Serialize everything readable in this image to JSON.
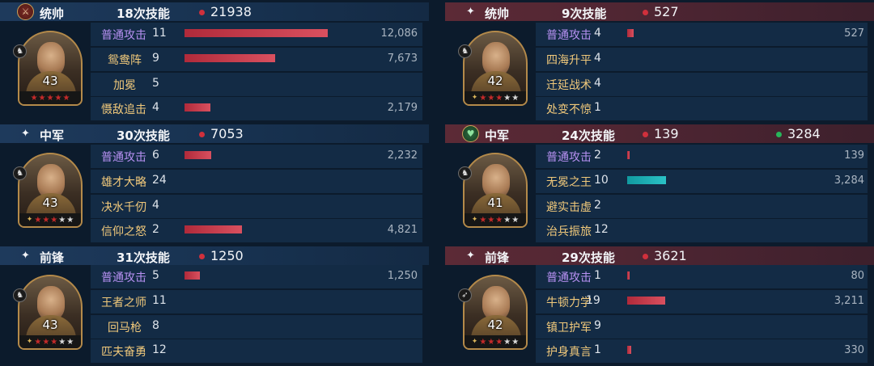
{
  "left": {
    "groups": [
      {
        "role": "统帅",
        "icon": "sword-badge-icon",
        "skills_used": "18次技能",
        "damage_total": "21938",
        "general": {
          "level": "43",
          "stars_red": 5,
          "stars_total": 5,
          "type_icon": "cavalry-icon"
        },
        "rows": [
          {
            "name": "普通攻击",
            "kind": "normal",
            "count": "11",
            "value": "12,086",
            "bar": 1.0,
            "bar_color": "red"
          },
          {
            "name": "鸳鸯阵",
            "kind": "skill",
            "count": "9",
            "value": "7,673",
            "bar": 0.635,
            "bar_color": "red"
          },
          {
            "name": "加冕",
            "kind": "skill",
            "count": "5",
            "value": "",
            "bar": 0,
            "bar_color": "red"
          },
          {
            "name": "慑敌追击",
            "kind": "skill",
            "count": "4",
            "value": "2,179",
            "bar": 0.18,
            "bar_color": "red"
          }
        ]
      },
      {
        "role": "中军",
        "icon": "sparkle-icon",
        "skills_used": "30次技能",
        "damage_total": "7053",
        "general": {
          "level": "43",
          "stars_red": 3,
          "stars_total": 5,
          "type_icon": "cavalry-icon"
        },
        "rows": [
          {
            "name": "普通攻击",
            "kind": "normal",
            "count": "6",
            "value": "2,232",
            "bar": 0.185,
            "bar_color": "red"
          },
          {
            "name": "雄才大略",
            "kind": "skill",
            "count": "24",
            "value": "",
            "bar": 0,
            "bar_color": "red"
          },
          {
            "name": "决水千仞",
            "kind": "skill",
            "count": "4",
            "value": "",
            "bar": 0,
            "bar_color": "red"
          },
          {
            "name": "信仰之怒",
            "kind": "skill",
            "count": "2",
            "value": "4,821",
            "bar": 0.4,
            "bar_color": "red"
          }
        ]
      },
      {
        "role": "前锋",
        "icon": "sparkle-icon",
        "skills_used": "31次技能",
        "damage_total": "1250",
        "general": {
          "level": "43",
          "stars_red": 3,
          "stars_total": 5,
          "type_icon": "cavalry-icon"
        },
        "rows": [
          {
            "name": "普通攻击",
            "kind": "normal",
            "count": "5",
            "value": "1,250",
            "bar": 0.105,
            "bar_color": "red"
          },
          {
            "name": "王者之师",
            "kind": "skill",
            "count": "11",
            "value": "",
            "bar": 0,
            "bar_color": "red"
          },
          {
            "name": "回马枪",
            "kind": "skill",
            "count": "8",
            "value": "",
            "bar": 0,
            "bar_color": "red"
          },
          {
            "name": "匹夫奋勇",
            "kind": "skill",
            "count": "12",
            "value": "",
            "bar": 0,
            "bar_color": "red"
          }
        ]
      }
    ]
  },
  "right": {
    "groups": [
      {
        "role": "统帅",
        "icon": "sparkle-icon",
        "skills_used": "9次技能",
        "damage_total": "527",
        "heal_total": "",
        "general": {
          "level": "42",
          "stars_red": 3,
          "stars_total": 5,
          "type_icon": "cavalry-icon"
        },
        "rows": [
          {
            "name": "普通攻击",
            "kind": "normal",
            "count": "4",
            "value": "527",
            "bar": 0.043,
            "bar_color": "red"
          },
          {
            "name": "四海升平",
            "kind": "skill",
            "count": "4",
            "value": "",
            "bar": 0,
            "bar_color": "red"
          },
          {
            "name": "迁延战术",
            "kind": "skill",
            "count": "4",
            "value": "",
            "bar": 0,
            "bar_color": "red"
          },
          {
            "name": "处变不惊",
            "kind": "skill",
            "count": "1",
            "value": "",
            "bar": 0,
            "bar_color": "red"
          }
        ]
      },
      {
        "role": "中军",
        "icon": "heart-badge-icon",
        "skills_used": "24次技能",
        "damage_total": "139",
        "heal_total": "3284",
        "general": {
          "level": "41",
          "stars_red": 3,
          "stars_total": 5,
          "type_icon": "cavalry-icon"
        },
        "rows": [
          {
            "name": "普通攻击",
            "kind": "normal",
            "count": "2",
            "value": "139",
            "bar": 0.011,
            "bar_color": "red"
          },
          {
            "name": "无冕之王",
            "kind": "skill",
            "count": "10",
            "value": "3,284",
            "bar": 0.27,
            "bar_color": "teal"
          },
          {
            "name": "避实击虚",
            "kind": "skill",
            "count": "2",
            "value": "",
            "bar": 0,
            "bar_color": "red"
          },
          {
            "name": "治兵振旅",
            "kind": "skill",
            "count": "12",
            "value": "",
            "bar": 0,
            "bar_color": "red"
          }
        ]
      },
      {
        "role": "前锋",
        "icon": "sparkle-icon",
        "skills_used": "29次技能",
        "damage_total": "3621",
        "heal_total": "",
        "general": {
          "level": "42",
          "stars_red": 3,
          "stars_total": 5,
          "type_icon": "archer-icon"
        },
        "rows": [
          {
            "name": "普通攻击",
            "kind": "normal",
            "count": "1",
            "value": "80",
            "bar": 0.007,
            "bar_color": "red"
          },
          {
            "name": "牛顿力学",
            "kind": "skill",
            "count": "19",
            "value": "3,211",
            "bar": 0.265,
            "bar_color": "red"
          },
          {
            "name": "镇卫护军",
            "kind": "skill",
            "count": "9",
            "value": "",
            "bar": 0,
            "bar_color": "red"
          },
          {
            "name": "护身真言",
            "kind": "skill",
            "count": "1",
            "value": "330",
            "bar": 0.027,
            "bar_color": "red"
          }
        ]
      }
    ]
  },
  "colors": {
    "normal_attack_text": "#b791f2",
    "skill_text": "#f1c97b",
    "damage_dot": "#d0303c",
    "heal_dot": "#27b55a",
    "damage_bar": "#c23a49",
    "heal_bar": "#1fb0b4"
  }
}
